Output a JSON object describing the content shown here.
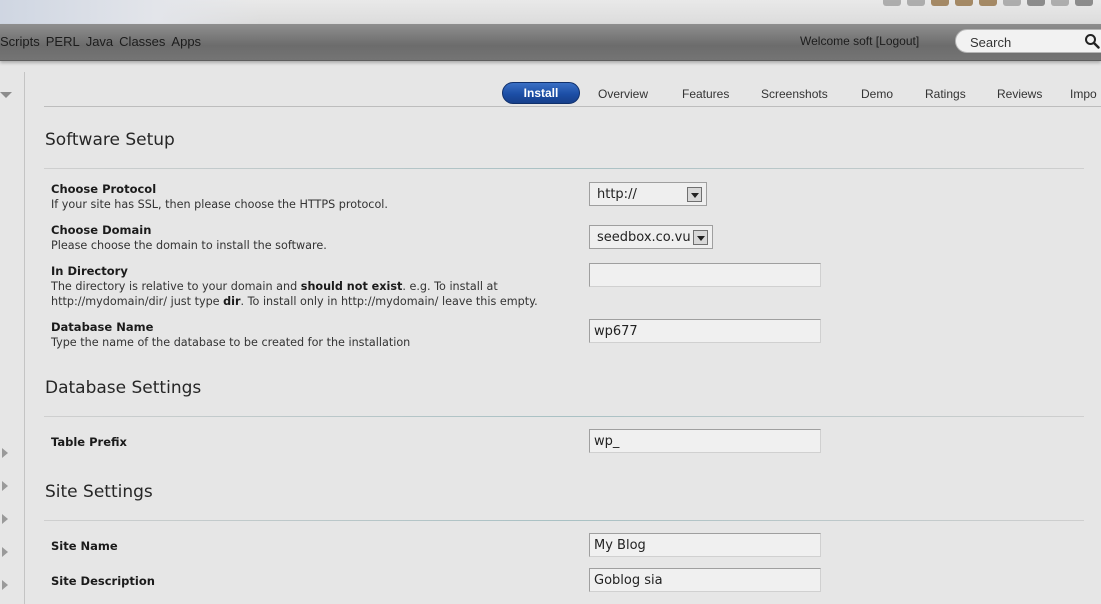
{
  "nav": {
    "links": [
      "Scripts",
      "PERL",
      "Java",
      "Classes",
      "Apps"
    ],
    "welcome_prefix": "Welcome soft [",
    "logout_label": "Logout",
    "welcome_suffix": "]",
    "search_placeholder": "Search"
  },
  "tabs": {
    "active": "Install",
    "items": [
      "Overview",
      "Features",
      "Screenshots",
      "Demo",
      "Ratings",
      "Reviews",
      "Impo"
    ]
  },
  "software_setup": {
    "title": "Software Setup",
    "protocol": {
      "label": "Choose Protocol",
      "desc": "If your site has SSL, then please choose the HTTPS protocol.",
      "value": "http://"
    },
    "domain": {
      "label": "Choose Domain",
      "desc": "Please choose the domain to install the software.",
      "value": "seedbox.co.vu"
    },
    "directory": {
      "label": "In Directory",
      "desc_1a": "The directory is relative to your domain and ",
      "desc_1b": "should not exist",
      "desc_1c": ". e.g. To install at",
      "desc_2a": "http://mydomain/dir/ just type ",
      "desc_2b": "dir",
      "desc_2c": ". To install only in http://mydomain/ leave this empty.",
      "value": ""
    },
    "database": {
      "label": "Database Name",
      "desc": "Type the name of the database to be created for the installation",
      "value": "wp677"
    }
  },
  "database_settings": {
    "title": "Database Settings",
    "table_prefix": {
      "label": "Table Prefix",
      "value": "wp_"
    }
  },
  "site_settings": {
    "title": "Site Settings",
    "site_name": {
      "label": "Site Name",
      "value": "My Blog"
    },
    "site_description": {
      "label": "Site Description",
      "value": "Goblog sia"
    }
  },
  "colors": {
    "active_tab": "#1c4ea6",
    "navbar": "#7a7a7a",
    "background": "#e6e6e6"
  }
}
